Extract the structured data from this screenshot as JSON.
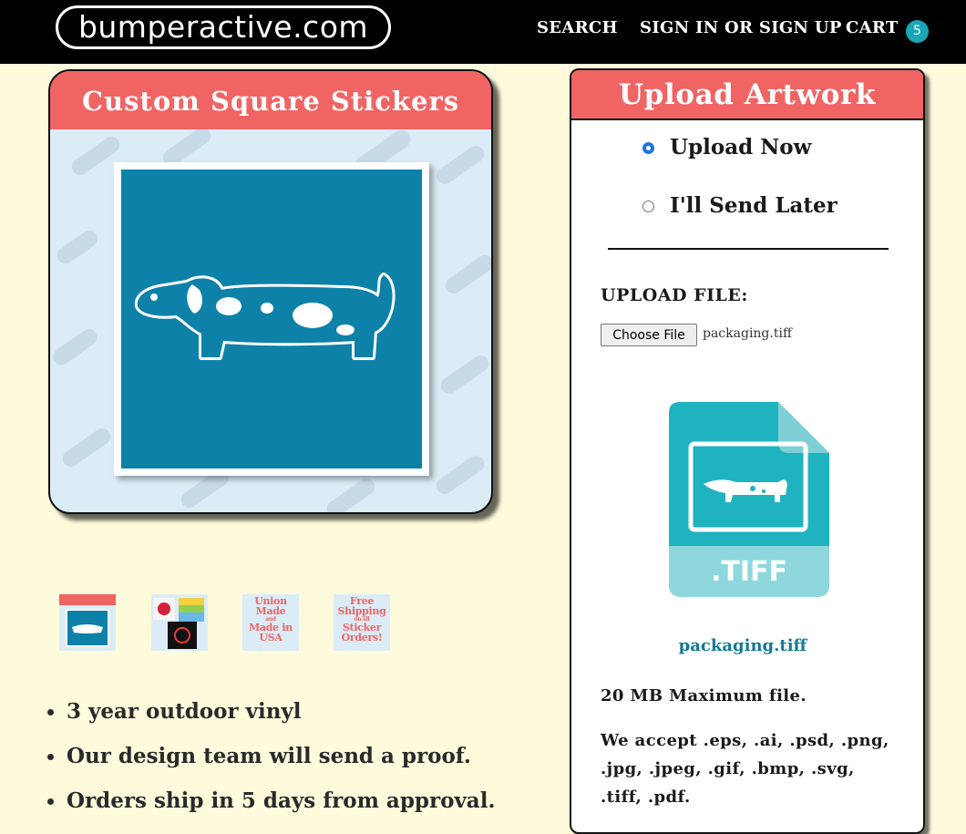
{
  "header": {
    "logo": "bumperactive.com",
    "nav": {
      "search": "SEARCH",
      "signin": "SIGN IN OR SIGN UP",
      "cart": "CART",
      "cart_count": "5"
    }
  },
  "product": {
    "image_title": "Custom  Square Stickers",
    "thumbnails": [
      {
        "name": "custom-square-stickers"
      },
      {
        "name": "sticker-samples"
      },
      {
        "name": "union-made",
        "text": [
          "Union",
          "Made",
          "and",
          "Made in",
          "USA"
        ]
      },
      {
        "name": "free-shipping",
        "text": [
          "Free",
          "Shipping",
          "on all",
          "Sticker",
          "Orders!"
        ]
      }
    ],
    "features": [
      "3 year outdoor vinyl",
      "Our design team will send a proof.",
      "Orders ship in 5 days from approval."
    ]
  },
  "upload": {
    "title": "Upload Artwork",
    "options": [
      {
        "label": "Upload Now",
        "checked": true
      },
      {
        "label": "I'll Send Later",
        "checked": false
      }
    ],
    "file_label": "UPLOAD FILE:",
    "choose_button": "Choose File",
    "chosen_file": "packaging.tiff",
    "preview_ext": ".TIFF",
    "file_link": "packaging.tiff",
    "max_size": "20 MB Maximum file.",
    "accepted": "We accept .eps, .ai, .psd, .png, .jpg, .jpeg, .gif, .bmp, .svg, .tiff, .pdf."
  },
  "colors": {
    "page_bg": "#fdfbdc",
    "header_bg": "#000000",
    "accent_red": "#f06464",
    "sticker_blue": "#0e81a9",
    "badge_teal": "#19a6b6",
    "link_teal": "#127a95"
  }
}
